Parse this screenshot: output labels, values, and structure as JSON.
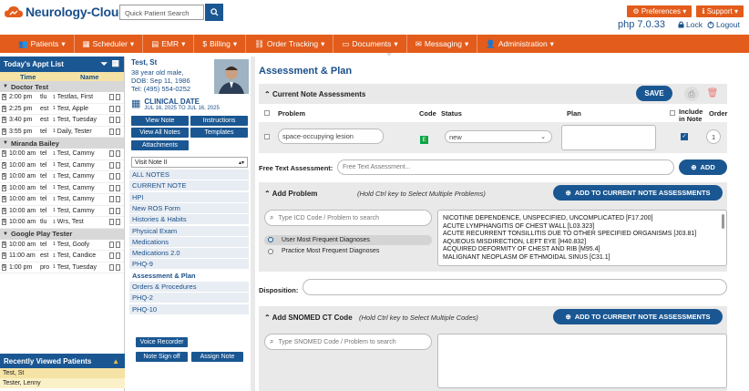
{
  "app": {
    "name": "Neurology-Cloud",
    "search_placeholder": "Quick Patient Search",
    "version": "php 7.0.33",
    "lock": "Lock",
    "logout": "Logout",
    "preferences": "Preferences",
    "support": "Support"
  },
  "nav": [
    "Patients",
    "Scheduler",
    "EMR",
    "Billing",
    "Order Tracking",
    "Documents",
    "Messaging",
    "Administration"
  ],
  "appt_list": {
    "title": "Today's Appt List",
    "col_time": "Time",
    "col_name": "Name",
    "groups": [
      {
        "name": "Doctor Test",
        "appts": [
          {
            "time": "2:00 pm",
            "type": "tlu",
            "name": "Testlas, First"
          },
          {
            "time": "2:25 pm",
            "type": "est",
            "name": "Test, Apple"
          },
          {
            "time": "3:40 pm",
            "type": "est",
            "name": "Test, Tuesday"
          },
          {
            "time": "3:55 pm",
            "type": "tel",
            "name": "Daily, Tester"
          }
        ]
      },
      {
        "name": "Miranda Bailey",
        "appts": [
          {
            "time": "10:00 am",
            "type": "tel",
            "name": "Test, Cammy"
          },
          {
            "time": "10:00 am",
            "type": "tel",
            "name": "Test, Cammy"
          },
          {
            "time": "10:00 am",
            "type": "tel",
            "name": "Test, Cammy"
          },
          {
            "time": "10:00 am",
            "type": "tel",
            "name": "Test, Cammy"
          },
          {
            "time": "10:00 am",
            "type": "tel",
            "name": "Test, Cammy"
          },
          {
            "time": "10:00 am",
            "type": "tel",
            "name": "Test, Cammy"
          },
          {
            "time": "10:00 am",
            "type": "tlu",
            "name": "Wrs, Test"
          }
        ]
      },
      {
        "name": "Google Play Tester",
        "appts": [
          {
            "time": "10:00 am",
            "type": "tel",
            "name": "Test, Goofy"
          },
          {
            "time": "11:00 am",
            "type": "est",
            "name": "Test, Candice"
          },
          {
            "time": "1:00 pm",
            "type": "pro",
            "name": "Test, Tuesday"
          }
        ]
      }
    ]
  },
  "recent": {
    "title": "Recently Viewed Patients",
    "items": [
      "Test, St",
      "Tester, Lenny"
    ]
  },
  "patient": {
    "name": "Test, St",
    "line1": "38 year old male,",
    "dob": "DOB: Sep 11, 1986",
    "tel": "Tel: (495) 554-0252",
    "clinical_title": "CLINICAL DATE",
    "clinical_range": "JUL 16, 2025 TO JUL 16, 2025"
  },
  "mid_buttons": {
    "view_note": "View Note",
    "instructions": "Instructions",
    "view_all": "View All Notes",
    "templates": "Templates",
    "attachments": "Attachments",
    "voice": "Voice Recorder",
    "sign_off": "Note Sign off",
    "assign": "Assign Note"
  },
  "visit_note": "Visit Note II",
  "note_items": [
    "ALL NOTES",
    "CURRENT NOTE",
    "HPI",
    "New ROS Form",
    "Histories & Habits",
    "Physical Exam",
    "Medications",
    "Medications 2.0",
    "PHQ-9",
    "Assessment & Plan",
    "Orders & Procedures",
    "PHQ-2",
    "PHQ-10"
  ],
  "main": {
    "title": "Assessment & Plan",
    "current_header": "Current Note Assessments",
    "save": "SAVE",
    "cols": {
      "problem": "Problem",
      "code": "Code",
      "status": "Status",
      "plan": "Plan",
      "include": "Include in Note",
      "order": "Order"
    },
    "row": {
      "problem": "space-occupying lesion",
      "code": "E",
      "status": "new",
      "order": "1"
    },
    "free_text_label": "Free Text Assessment:",
    "free_text_placeholder": "Free Text Assessment...",
    "add": "ADD",
    "add_problem": "Add Problem",
    "add_problem_hint": "(Hold Ctrl key to Select Multiple Problems)",
    "add_to_current": "ADD TO CURRENT NOTE ASSESSMENTS",
    "icd_placeholder": "Type ICD Code / Problem to search",
    "user_freq": "User Most Frequent Diagnoses",
    "practice_freq": "Practice Most Frequent Diagnoses",
    "diagnoses": [
      "NICOTINE DEPENDENCE, UNSPECIFIED, UNCOMPLICATED [F17.200]",
      "ACUTE LYMPHANGITIS OF CHEST WALL [L03.323]",
      "ACUTE RECURRENT TONSILLITIS DUE TO OTHER SPECIFIED ORGANISMS [J03.81]",
      "AQUEOUS MISDIRECTION, LEFT EYE [H40.832]",
      "ACQUIRED DEFORMITY OF CHEST AND RIB [M95.4]",
      "MALIGNANT NEOPLASM OF ETHMOIDAL SINUS [C31.1]"
    ],
    "disposition": "Disposition:",
    "add_snomed": "Add SNOMED CT Code",
    "add_snomed_hint": "(Hold Ctrl key to Select Multiple Codes)",
    "snomed_placeholder": "Type SNOMED Code / Problem to search"
  },
  "colors": {
    "navy": "#1a5792",
    "orange": "#e35c1b",
    "section": "#e9e9e9"
  }
}
